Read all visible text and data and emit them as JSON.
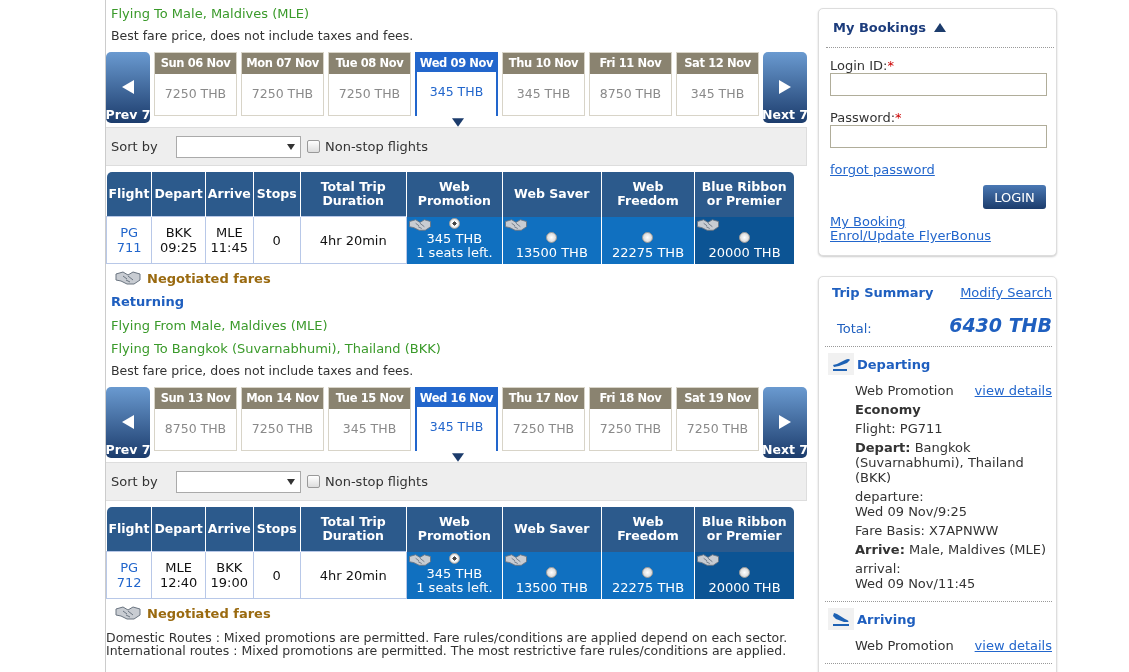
{
  "legs": [
    {
      "route_lines": [
        "Flying To Male, Maldives (MLE)"
      ],
      "note": "Best fare price, does not include taxes and fees.",
      "prev": "Prev 7",
      "next": "Next 7",
      "days": [
        {
          "label": "Sun 06 Nov",
          "price": "7250 THB",
          "selected": false
        },
        {
          "label": "Mon 07 Nov",
          "price": "7250 THB",
          "selected": false
        },
        {
          "label": "Tue 08 Nov",
          "price": "7250 THB",
          "selected": false
        },
        {
          "label": "Wed 09 Nov",
          "price": "345 THB",
          "selected": true
        },
        {
          "label": "Thu 10 Nov",
          "price": "345 THB",
          "selected": false
        },
        {
          "label": "Fri 11 Nov",
          "price": "8750 THB",
          "selected": false
        },
        {
          "label": "Sat 12 Nov",
          "price": "345 THB",
          "selected": false
        }
      ],
      "sort_label": "Sort by",
      "nonstop": {
        "label": "Non-stop flights",
        "checked": false
      },
      "columns": [
        "Flight",
        "Depart",
        "Arrive",
        "Stops",
        "Total Trip Duration",
        "Web Promotion",
        "Web Saver",
        "Web Freedom",
        "Blue Ribbon or Premier"
      ],
      "flight": {
        "number": "PG 711",
        "depart": [
          "BKK",
          "09:25"
        ],
        "arrive": [
          "MLE",
          "11:45"
        ],
        "stops": "0",
        "duration": "4hr 20min",
        "fares": [
          {
            "price": "345 THB",
            "seats": "1 seats left.",
            "selected": true,
            "negotiated": true
          },
          {
            "price": "13500 THB",
            "selected": false,
            "negotiated": true
          },
          {
            "price": "22275 THB",
            "selected": false,
            "negotiated": false
          },
          {
            "price": "20000 THB",
            "selected": false,
            "negotiated": true
          }
        ]
      },
      "negotiated_label": "Negotiated fares"
    },
    {
      "title": "Returning",
      "route_lines": [
        "Flying From Male, Maldives (MLE)",
        "Flying To Bangkok (Suvarnabhumi), Thailand (BKK)"
      ],
      "note": "Best fare price, does not include taxes and fees.",
      "prev": "Prev 7",
      "next": "Next 7",
      "days": [
        {
          "label": "Sun 13 Nov",
          "price": "8750 THB",
          "selected": false
        },
        {
          "label": "Mon 14 Nov",
          "price": "7250 THB",
          "selected": false
        },
        {
          "label": "Tue 15 Nov",
          "price": "345 THB",
          "selected": false
        },
        {
          "label": "Wed 16 Nov",
          "price": "345 THB",
          "selected": true
        },
        {
          "label": "Thu 17 Nov",
          "price": "7250 THB",
          "selected": false
        },
        {
          "label": "Fri 18 Nov",
          "price": "7250 THB",
          "selected": false
        },
        {
          "label": "Sat 19 Nov",
          "price": "7250 THB",
          "selected": false
        }
      ],
      "sort_label": "Sort by",
      "nonstop": {
        "label": "Non-stop flights",
        "checked": false
      },
      "columns": [
        "Flight",
        "Depart",
        "Arrive",
        "Stops",
        "Total Trip Duration",
        "Web Promotion",
        "Web Saver",
        "Web Freedom",
        "Blue Ribbon or Premier"
      ],
      "flight": {
        "number": "PG 712",
        "depart": [
          "MLE",
          "12:40"
        ],
        "arrive": [
          "BKK",
          "19:00"
        ],
        "stops": "0",
        "duration": "4hr 20min",
        "fares": [
          {
            "price": "345 THB",
            "seats": "1 seats left.",
            "selected": true,
            "negotiated": true
          },
          {
            "price": "13500 THB",
            "selected": false,
            "negotiated": true
          },
          {
            "price": "22275 THB",
            "selected": false,
            "negotiated": false
          },
          {
            "price": "20000 THB",
            "selected": false,
            "negotiated": true
          }
        ]
      },
      "negotiated_label": "Negotiated fares"
    }
  ],
  "footnotes": [
    "Domestic Routes : Mixed promotions are permitted. Fare rules/conditions are applied depend on each sector.",
    "International routes : Mixed promotions are permitted. The most restrictive fare rules/conditions are applied."
  ],
  "bookings": {
    "title": "My Bookings",
    "login_label": "Login ID:",
    "password_label": "Password:",
    "required": "*",
    "forgot": "forgot password",
    "login_button": "LOGIN",
    "links": [
      "My Booking",
      "Enrol/Update FlyerBonus"
    ]
  },
  "summary": {
    "title": "Trip Summary",
    "modify": "Modify Search",
    "total_label": "Total:",
    "total": "6430 THB",
    "sections": [
      {
        "kind": "departing",
        "title": "Departing",
        "fare": "Web Promotion",
        "details_link": "view details",
        "lines": [
          {
            "text": "Economy",
            "kind": "bold"
          },
          {
            "text": "Flight: PG711",
            "kind": "plain"
          },
          {
            "text": "**Depart:** Bangkok (Suvarnabhumi), Thailand (BKK)",
            "kind": "plain"
          },
          {
            "text": "departure:",
            "kind": "label"
          },
          {
            "text": "Wed 09 Nov/9:25",
            "kind": "value"
          },
          {
            "text": "Fare Basis: X7APNWW",
            "kind": "plain"
          },
          {
            "text": "**Arrive:** Male, Maldives (MLE)",
            "kind": "plain"
          },
          {
            "text": "arrival:",
            "kind": "label"
          },
          {
            "text": "Wed 09 Nov/11:45",
            "kind": "value"
          }
        ]
      },
      {
        "kind": "arriving",
        "title": "Arriving",
        "fare": "Web Promotion",
        "details_link": "view details"
      }
    ]
  }
}
